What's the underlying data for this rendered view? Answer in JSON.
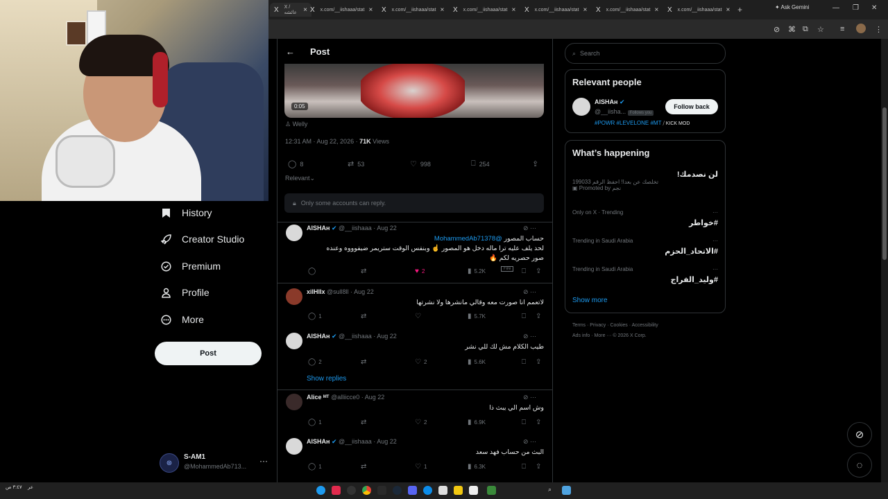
{
  "browser": {
    "tabs": [
      {
        "title": "X / عائشه",
        "active": true
      },
      {
        "title": "x.com/__iishaaa/stat"
      },
      {
        "title": "x.com/__iishaaa/stat"
      },
      {
        "title": "x.com/__iishaaa/stat"
      },
      {
        "title": "x.com/__iishaaa/stat"
      },
      {
        "title": "x.com/__iishaaa/stat"
      },
      {
        "title": "x.com/__iishaaa/stat"
      }
    ],
    "new_tab": "+",
    "gemini": "Ask Gemini"
  },
  "nav": {
    "items": [
      {
        "label": "History",
        "icon": "bookmark-icon"
      },
      {
        "label": "Creator Studio",
        "icon": "rocket-icon"
      },
      {
        "label": "Premium",
        "icon": "verified-icon"
      },
      {
        "label": "Profile",
        "icon": "person-icon"
      },
      {
        "label": "More",
        "icon": "more-circle-icon"
      }
    ],
    "post_button": "Post",
    "account": {
      "name": "S-AM1",
      "handle": "@MohammedAb713..."
    }
  },
  "post": {
    "header": "Post",
    "video_time": "0:05",
    "caption": "Welly",
    "time": "12:31 AM · Aug 22, 2026 ·",
    "views": "71K",
    "views_label": "Views",
    "replies": "8",
    "reposts": "53",
    "likes": "998",
    "bookmarks": "254",
    "sort": "Relevant",
    "reply_restriction": "Only some accounts can reply."
  },
  "tweets": [
    {
      "name": "AISHAʜ",
      "handle": "@__iishaaa · Aug 22",
      "mention": "@MohammedAb71378",
      "line1": "حساب المصور",
      "line2": "لحد يلف عليه ترا ماله دخل هو المصور ☝️ وبنفس الوقت ستريمر ضيفوووه وعنده",
      "line3": "صور حصريه لكم 🔥",
      "likes": "2",
      "views": "5.2K",
      "tooltip": "Fire"
    },
    {
      "name": "xilHlIx",
      "handle": "@sull8ll · Aug 22",
      "text": "لاتعمم انا صورت معه وقالي مانشرها ولا نشرتها",
      "replies": "1",
      "views": "5.7K"
    },
    {
      "name": "AISHAʜ",
      "handle": "@__iishaaa · Aug 22",
      "text": "طيب الكلام مش لك للي نشر",
      "replies": "2",
      "likes": "2",
      "views": "5.6K"
    },
    {
      "name": "Alice ᴹᵀ",
      "handle": "@alliicce0 · Aug 22",
      "text": "وش اسم الي يبث ذا",
      "replies": "1",
      "likes": "2",
      "views": "6.9K"
    },
    {
      "name": "AISHAʜ",
      "handle": "@__iishaaa · Aug 22",
      "text": "البث من حساب فهد سعد",
      "replies": "1",
      "likes": "1",
      "views": "6.3K"
    }
  ],
  "show_replies": "Show replies",
  "sidebar": {
    "search_placeholder": "Search",
    "relevant_title": "Relevant people",
    "person": {
      "name": "AISHAʜ",
      "handle": "@__iisha...",
      "follows_you": "Follows you",
      "button": "Follow back",
      "bio_tags": "#POWR #LEVELONE #MT",
      "bio_rest": "⧸ KICK MOD"
    },
    "happening_title": "What’s happening",
    "promo": {
      "title": "لن نصدمك!",
      "sub": "تخلصك عن بعدا! احفظ الرقم 199033",
      "promoted": "Promoted by نجم"
    },
    "trends": [
      {
        "context": "Only on X · Trending",
        "name": "#خواطر"
      },
      {
        "context": "Trending in Saudi Arabia",
        "name": "#الاتحاد_الحزم"
      },
      {
        "context": "Trending in Saudi Arabia",
        "name": "#وليد_الفراج"
      }
    ],
    "show_more": "Show more",
    "footer1": [
      "Terms",
      "Privacy",
      "Cookies",
      "Accessibility"
    ],
    "footer2": [
      "Ads info",
      "More ···",
      "© 2026 X Corp."
    ]
  },
  "taskbar": {
    "lang": "عر",
    "clock": "٣:٤٧ ص"
  },
  "colors": {
    "accent": "#1d9bf0",
    "like": "#f91880",
    "bg": "#000000"
  }
}
